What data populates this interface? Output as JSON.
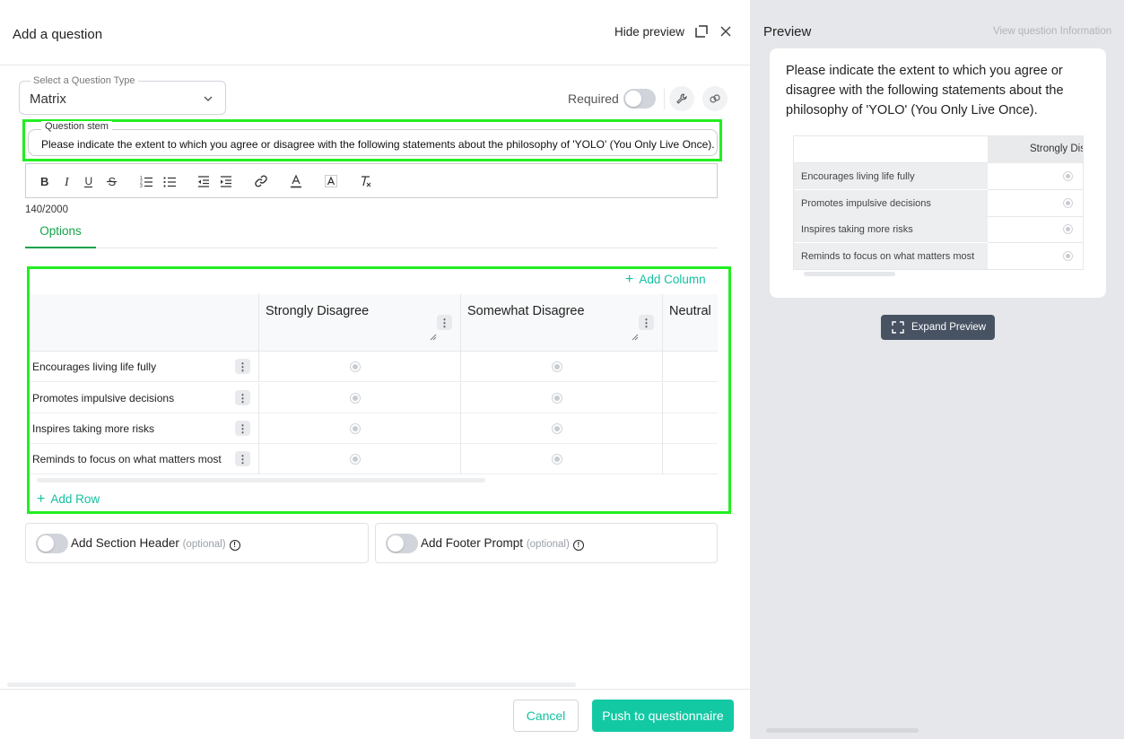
{
  "header": {
    "title": "Add a question",
    "hide_preview": "Hide preview"
  },
  "question_type": {
    "legend": "Select a Question Type",
    "value": "Matrix"
  },
  "required": {
    "label": "Required",
    "on": false
  },
  "stem": {
    "legend": "Question stem",
    "text": "Please indicate the extent to which you agree or disagree with the following statements about the philosophy of 'YOLO' (You Only Live Once)."
  },
  "counter": "140/2000",
  "tabs": {
    "options": "Options"
  },
  "matrix": {
    "add_column": "Add Column",
    "add_row": "Add Row",
    "columns": [
      "Strongly Disagree",
      "Somewhat Disagree",
      "Neutral"
    ],
    "rows": [
      "Encourages living life fully",
      "Promotes impulsive decisions",
      "Inspires taking more risks",
      "Reminds to focus on what matters most"
    ]
  },
  "section_header": {
    "label": "Add Section Header",
    "optional": "(optional)"
  },
  "footer_prompt": {
    "label": "Add Footer Prompt",
    "optional": "(optional)"
  },
  "footer": {
    "cancel": "Cancel",
    "push": "Push to questionnaire"
  },
  "preview": {
    "title": "Preview",
    "view_info": "View question Information",
    "question": "Please indicate the extent to which you agree or disagree with the following statements about the philosophy of 'YOLO' (You Only Live Once).",
    "column": "Strongly Disa",
    "rows": [
      "Encourages living life fully",
      "Promotes impulsive decisions",
      "Inspires taking more risks",
      "Reminds to focus on what matters most"
    ],
    "expand": "Expand Preview"
  },
  "colors": {
    "accent": "#13c9a4",
    "tab_active": "#16a34a",
    "highlight": "#22ee22"
  }
}
